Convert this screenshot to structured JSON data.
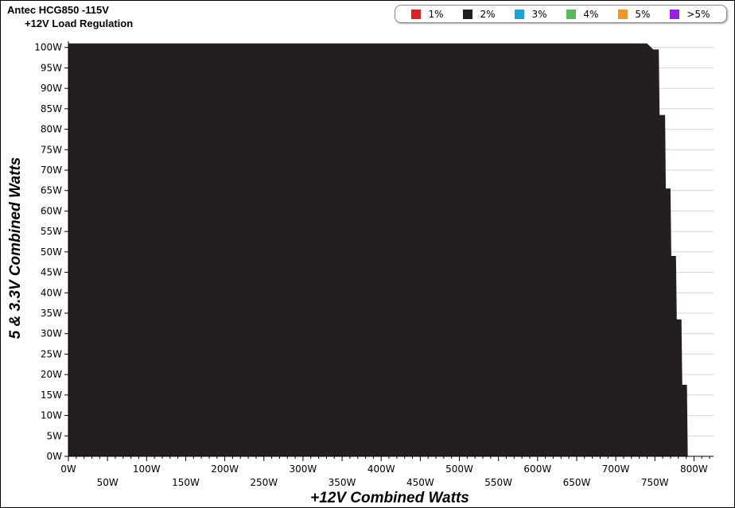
{
  "header": {
    "title": "Antec HCG850 -115V",
    "subtitle": "+12V Load Regulation"
  },
  "legend": [
    {
      "label": "1%",
      "color": "#e02020"
    },
    {
      "label": "2%",
      "color": "#231f20"
    },
    {
      "label": "3%",
      "color": "#1aa3d9"
    },
    {
      "label": "4%",
      "color": "#5cb85c"
    },
    {
      "label": "5%",
      "color": "#f0962a"
    },
    {
      "label": ">5%",
      "color": "#9b1de8"
    }
  ],
  "chart_data": {
    "type": "area",
    "xlabel": "+12V Combined Watts",
    "ylabel": "5 & 3.3V Combined Watts",
    "xlim": [
      0,
      825
    ],
    "ylim": [
      0,
      101.5
    ],
    "x_ticks": [
      "0W",
      "50W",
      "100W",
      "150W",
      "200W",
      "250W",
      "300W",
      "350W",
      "400W",
      "450W",
      "500W",
      "550W",
      "600W",
      "650W",
      "700W",
      "750W",
      "800W"
    ],
    "y_ticks": [
      "0W",
      "5W",
      "10W",
      "15W",
      "20W",
      "25W",
      "30W",
      "35W",
      "40W",
      "45W",
      "50W",
      "55W",
      "60W",
      "65W",
      "70W",
      "75W",
      "80W",
      "85W",
      "90W",
      "95W",
      "100W"
    ],
    "grid": true,
    "series": [
      {
        "name": "2%",
        "color": "#231f20",
        "points": [
          [
            0,
            101
          ],
          [
            740,
            101
          ],
          [
            748,
            99.5
          ],
          [
            755,
            99.5
          ],
          [
            756,
            83.5
          ],
          [
            763,
            83.5
          ],
          [
            764,
            65.5
          ],
          [
            770,
            65.5
          ],
          [
            771,
            49
          ],
          [
            777,
            49
          ],
          [
            778,
            33.5
          ],
          [
            784,
            33.5
          ],
          [
            785,
            17.5
          ],
          [
            791,
            17.5
          ],
          [
            792,
            0
          ]
        ]
      }
    ]
  }
}
